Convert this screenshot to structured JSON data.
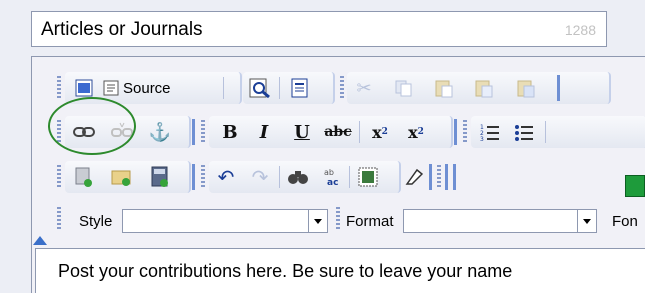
{
  "title_field": {
    "value": "Articles or Journals",
    "char_count": "1288"
  },
  "toolbar": {
    "source_label": "Source",
    "bold_label": "B",
    "italic_label": "I",
    "underline_label": "U",
    "strike_label": "abc",
    "subscript_label": "x",
    "superscript_label": "x"
  },
  "combos": {
    "style_label": "Style",
    "format_label": "Format",
    "font_label": "Fon"
  },
  "editor": {
    "content_text": "Post your contributions here. Be sure to leave your name"
  },
  "colors": {
    "highlight_circle": "#2d8a2d",
    "toolbar_accent": "#6e8fd3",
    "green_swatch": "#1e9b3b"
  }
}
